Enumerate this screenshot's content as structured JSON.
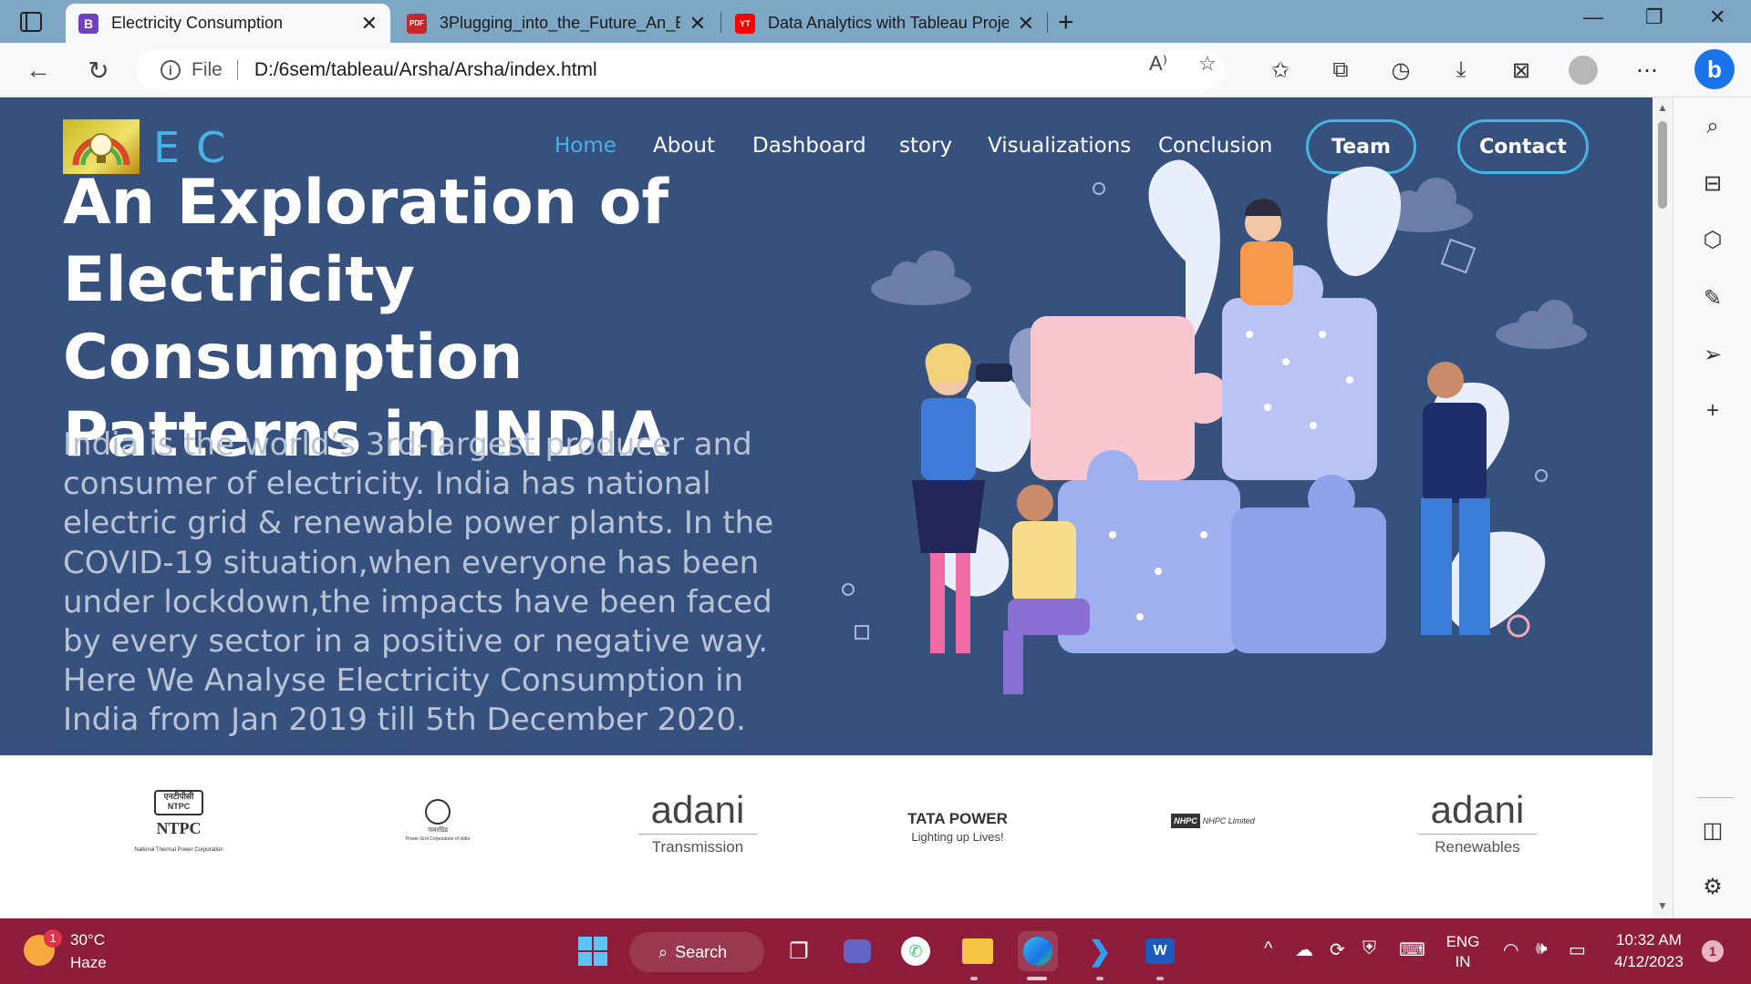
{
  "browser": {
    "tabs": [
      {
        "title": "Electricity Consumption",
        "favicon": "B",
        "favicon_color": "#6f42c1"
      },
      {
        "title": "3Plugging_into_the_Future_An_E",
        "favicon": "PDF",
        "favicon_color": "#c62828"
      },
      {
        "title": "Data Analytics with Tableau Proje",
        "favicon": "YT",
        "favicon_color": "#ff0000"
      }
    ],
    "address": {
      "scheme_label": "File",
      "url": "D:/6sem/tableau/Arsha/Arsha/index.html"
    }
  },
  "site": {
    "logo_text": "EC",
    "nav": {
      "home": "Home",
      "about": "About",
      "dashboard": "Dashboard",
      "story": "story",
      "visualizations": "Visualizations",
      "conclusion": "Conclusion",
      "team": "Team",
      "contact": "Contact"
    },
    "hero": {
      "title": "An Exploration of Electricity Consumption Patterns in INDIA",
      "description": "India is the world’s 3rd-largest producer and consumer of electricity. India has national electric grid & renewable power plants. In the COVID-19 situation,when everyone has been under lockdown,the impacts have been faced by every sector in a positive or negative way. Here We Analyse Electricity Consumption in India from Jan 2019 till 5th December 2020."
    },
    "clients": [
      {
        "name": "NTPC",
        "top": "एनटीपीसी NTPC",
        "sub": "National Thermal Power Corporation"
      },
      {
        "name": "POWERGRID",
        "top": "पावरग्रिड",
        "sub": "Power Grid Corporation of India"
      },
      {
        "name": "adani",
        "sub": "Transmission"
      },
      {
        "name": "TATA POWER",
        "sub": "Lighting up Lives!"
      },
      {
        "name": "NHPC Limited",
        "sub": "NHPC"
      },
      {
        "name": "adani",
        "sub": "Renewables"
      }
    ]
  },
  "taskbar": {
    "weather": {
      "temp": "30°C",
      "condition": "Haze",
      "badge": "1"
    },
    "search_label": "Search",
    "lang_top": "ENG",
    "lang_bottom": "IN",
    "time": "10:32 AM",
    "date": "4/12/2023",
    "notification_count": "1"
  },
  "colors": {
    "hero_bg": "#37517e",
    "accent": "#47b2e4",
    "tabstrip": "#7da7c4",
    "taskbar": "#8d1d3b"
  }
}
